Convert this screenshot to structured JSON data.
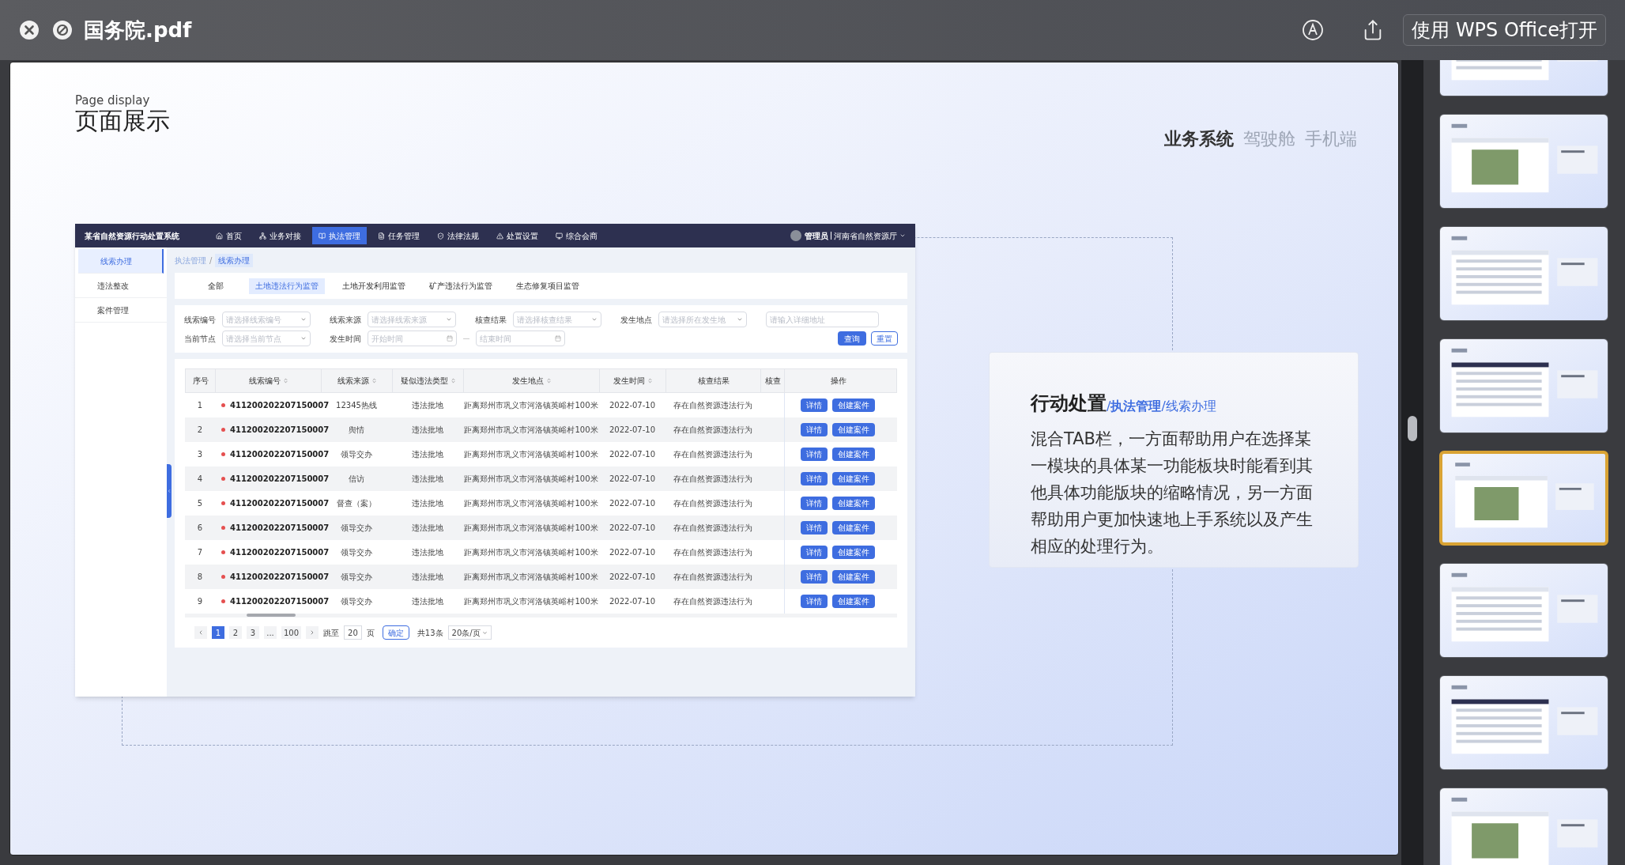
{
  "viewer": {
    "title": "国务院.pdf",
    "open_with": "使用 WPS Office打开"
  },
  "slide": {
    "heading_en": "Page display",
    "heading": "页面展示",
    "tabs": [
      {
        "label": "业务系统",
        "selected": true
      },
      {
        "label": "驾驶舱",
        "selected": false
      },
      {
        "label": "手机端",
        "selected": false
      }
    ]
  },
  "app": {
    "system_name": "某省自然资源行动处置系统",
    "nav": [
      {
        "label": "首页",
        "selected": false
      },
      {
        "label": "业务对接",
        "selected": false
      },
      {
        "label": "执法管理",
        "selected": true
      },
      {
        "label": "任务管理",
        "selected": false
      },
      {
        "label": "法律法规",
        "selected": false
      },
      {
        "label": "处置设置",
        "selected": false
      },
      {
        "label": "综合会商",
        "selected": false
      }
    ],
    "user": {
      "role": "管理员",
      "org": "河南省自然资源厅"
    },
    "sidebar": [
      {
        "label": "线索办理",
        "selected": true
      },
      {
        "label": "违法整改",
        "selected": false
      },
      {
        "label": "案件管理",
        "selected": false
      }
    ],
    "breadcrumb_separator": "/",
    "breadcrumb": [
      {
        "label": "执法管理",
        "current": false
      },
      {
        "label": "线索办理",
        "current": true
      }
    ],
    "category_tabs": [
      {
        "label": "全部",
        "selected": false
      },
      {
        "label": "土地违法行为监管",
        "selected": true
      },
      {
        "label": "土地开发利用监管",
        "selected": false
      },
      {
        "label": "矿产违法行为监管",
        "selected": false
      },
      {
        "label": "生态修复项目监管",
        "selected": false
      }
    ],
    "filters_row1": [
      {
        "kind": "select",
        "label": "线索编号",
        "placeholder": "请选择线索编号"
      },
      {
        "kind": "select",
        "label": "线索来源",
        "placeholder": "请选择线索来源"
      },
      {
        "kind": "select",
        "label": "核查结果",
        "placeholder": "请选择核查结果"
      },
      {
        "kind": "select",
        "label": "发生地点",
        "placeholder": "请选择所在发生地"
      },
      {
        "kind": "text",
        "placeholder": "请输入详细地址"
      }
    ],
    "filters_row2": [
      {
        "kind": "select",
        "label": "当前节点",
        "placeholder": "请选择当前节点"
      },
      {
        "kind": "date_range",
        "label": "发生时间",
        "placeholder": "开始时间",
        "placeholder_end": "结束时间"
      }
    ],
    "buttons": {
      "search": "查询",
      "reset": "重置"
    },
    "columns": [
      {
        "label": "序号",
        "sortable": false
      },
      {
        "label": "线索编号",
        "sortable": true
      },
      {
        "label": "线索来源",
        "sortable": true
      },
      {
        "label": "疑似违法类型",
        "sortable": true
      },
      {
        "label": "发生地点",
        "sortable": true
      },
      {
        "label": "发生时间",
        "sortable": true
      },
      {
        "label": "核查结果",
        "sortable": false
      },
      {
        "label": "核查",
        "sortable": false
      },
      {
        "label": "操作",
        "sortable": false
      }
    ],
    "rows": [
      {
        "index": "1",
        "flagged": true,
        "id": "411200202207150007",
        "source": "12345热线",
        "type": "违法批地",
        "location": "距离郑州市巩义市河洛镇英峪村100米",
        "date": "2022-07-10",
        "result": "存在自然资源违法行为",
        "actions": [
          "详情",
          "创建案件"
        ]
      },
      {
        "index": "2",
        "flagged": true,
        "id": "411200202207150007",
        "source": "舆情",
        "type": "违法批地",
        "location": "距离郑州市巩义市河洛镇英峪村100米",
        "date": "2022-07-10",
        "result": "存在自然资源违法行为",
        "actions": [
          "详情",
          "创建案件"
        ]
      },
      {
        "index": "3",
        "flagged": true,
        "id": "411200202207150007",
        "source": "领导交办",
        "type": "违法批地",
        "location": "距离郑州市巩义市河洛镇英峪村100米",
        "date": "2022-07-10",
        "result": "存在自然资源违法行为",
        "actions": [
          "详情",
          "创建案件"
        ]
      },
      {
        "index": "4",
        "flagged": true,
        "id": "411200202207150007",
        "source": "信访",
        "type": "违法批地",
        "location": "距离郑州市巩义市河洛镇英峪村100米",
        "date": "2022-07-10",
        "result": "存在自然资源违法行为",
        "actions": [
          "详情",
          "创建案件"
        ]
      },
      {
        "index": "5",
        "flagged": true,
        "id": "411200202207150007",
        "source": "督查（案）",
        "type": "违法批地",
        "location": "距离郑州市巩义市河洛镇英峪村100米",
        "date": "2022-07-10",
        "result": "存在自然资源违法行为",
        "actions": [
          "详情",
          "创建案件"
        ]
      },
      {
        "index": "6",
        "flagged": true,
        "id": "411200202207150007",
        "source": "领导交办",
        "type": "违法批地",
        "location": "距离郑州市巩义市河洛镇英峪村100米",
        "date": "2022-07-10",
        "result": "存在自然资源违法行为",
        "actions": [
          "详情",
          "创建案件"
        ]
      },
      {
        "index": "7",
        "flagged": true,
        "id": "411200202207150007",
        "source": "领导交办",
        "type": "违法批地",
        "location": "距离郑州市巩义市河洛镇英峪村100米",
        "date": "2022-07-10",
        "result": "存在自然资源违法行为",
        "actions": [
          "详情",
          "创建案件"
        ]
      },
      {
        "index": "8",
        "flagged": true,
        "id": "411200202207150007",
        "source": "领导交办",
        "type": "违法批地",
        "location": "距离郑州市巩义市河洛镇英峪村100米",
        "date": "2022-07-10",
        "result": "存在自然资源违法行为",
        "actions": [
          "详情",
          "创建案件"
        ]
      },
      {
        "index": "9",
        "flagged": true,
        "id": "411200202207150007",
        "source": "领导交办",
        "type": "违法批地",
        "location": "距离郑州市巩义市河洛镇英峪村100米",
        "date": "2022-07-10",
        "result": "存在自然资源违法行为",
        "actions": [
          "详情",
          "创建案件"
        ]
      }
    ],
    "pagination": {
      "pages": [
        {
          "label": "1",
          "selected": true
        },
        {
          "label": "2",
          "selected": false
        },
        {
          "label": "3",
          "selected": false
        },
        {
          "label": "...",
          "selected": false
        },
        {
          "label": "100",
          "selected": false
        }
      ],
      "jump_label": "跳至",
      "jump_value": "20",
      "page_unit": "页",
      "confirm": "确定",
      "total": "共13条",
      "page_size": "20条/页"
    }
  },
  "description": {
    "title": "行动处置",
    "path": "/**执法管理**/线索办理",
    "body": "混合TAB栏，一方面帮助用户在选择某一模块的具体某一功能板块时能看到其他具体功能版块的缩略情况，另一方面帮助用户更加快速地上手系统以及产生相应的处理行为。"
  },
  "thumbnails": [
    {
      "selected": false
    },
    {
      "selected": false
    },
    {
      "selected": false
    },
    {
      "selected": false
    },
    {
      "selected": true
    },
    {
      "selected": false
    },
    {
      "selected": false
    },
    {
      "selected": false
    }
  ]
}
